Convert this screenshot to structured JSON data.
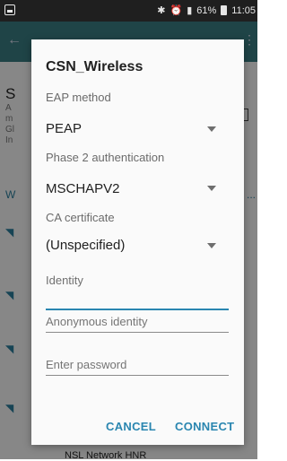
{
  "status_bar": {
    "battery": "61%",
    "time": "11:05"
  },
  "background": {
    "heading_letter": "S",
    "lines": [
      "A",
      "m",
      "Gl",
      "In"
    ],
    "wifi_section_letter": "W",
    "bottom_text": "NSL  Network HNR"
  },
  "dialog": {
    "title": "CSN_Wireless",
    "eap_method": {
      "label": "EAP method",
      "value": "PEAP"
    },
    "phase2": {
      "label": "Phase 2 authentication",
      "value": "MSCHAPV2"
    },
    "ca_cert": {
      "label": "CA certificate",
      "value": "(Unspecified)"
    },
    "identity": {
      "label": "Identity",
      "value": ""
    },
    "anonymous_identity": {
      "placeholder": "Anonymous identity"
    },
    "password": {
      "placeholder": "Enter password"
    },
    "cancel_label": "CANCEL",
    "connect_label": "CONNECT"
  }
}
